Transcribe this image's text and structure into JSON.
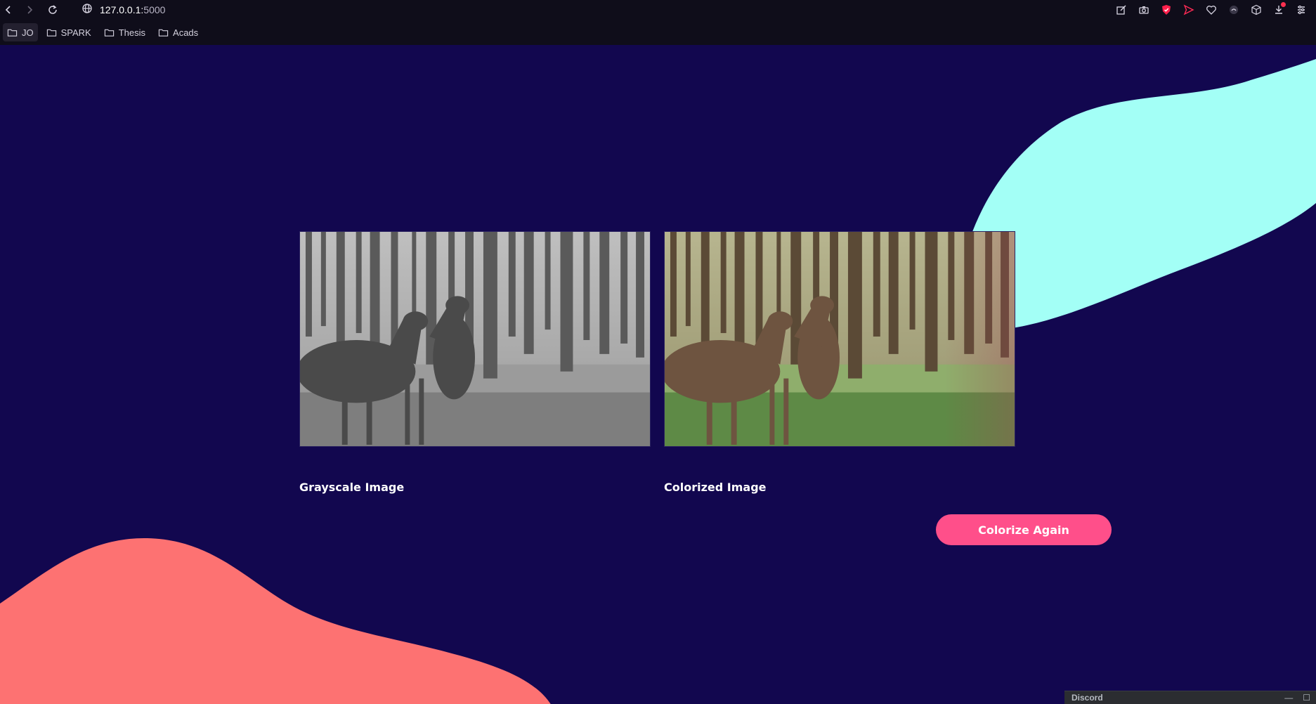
{
  "browser": {
    "url_host": "127.0.0.1:",
    "url_port": "5000",
    "bookmarks": [
      {
        "label": "JO"
      },
      {
        "label": "SPARK"
      },
      {
        "label": "Thesis"
      },
      {
        "label": "Acads"
      }
    ],
    "icons": [
      "back-icon",
      "forward-icon",
      "reload-icon",
      "site-info-icon",
      "edit-icon",
      "camera-icon",
      "shield-icon",
      "send-icon",
      "heart-icon",
      "extension-icon",
      "box-icon",
      "download-icon",
      "menu-icon"
    ]
  },
  "page": {
    "grayscale_caption": "Grayscale Image",
    "colorized_caption": "Colorized Image",
    "colorize_button": "Colorize Again",
    "colors": {
      "background": "#12074f",
      "blob_top_right": "#a3fff6",
      "blob_bottom_left": "#fd7272",
      "button": "#ff4f8a"
    }
  },
  "discord": {
    "title": "Discord"
  }
}
